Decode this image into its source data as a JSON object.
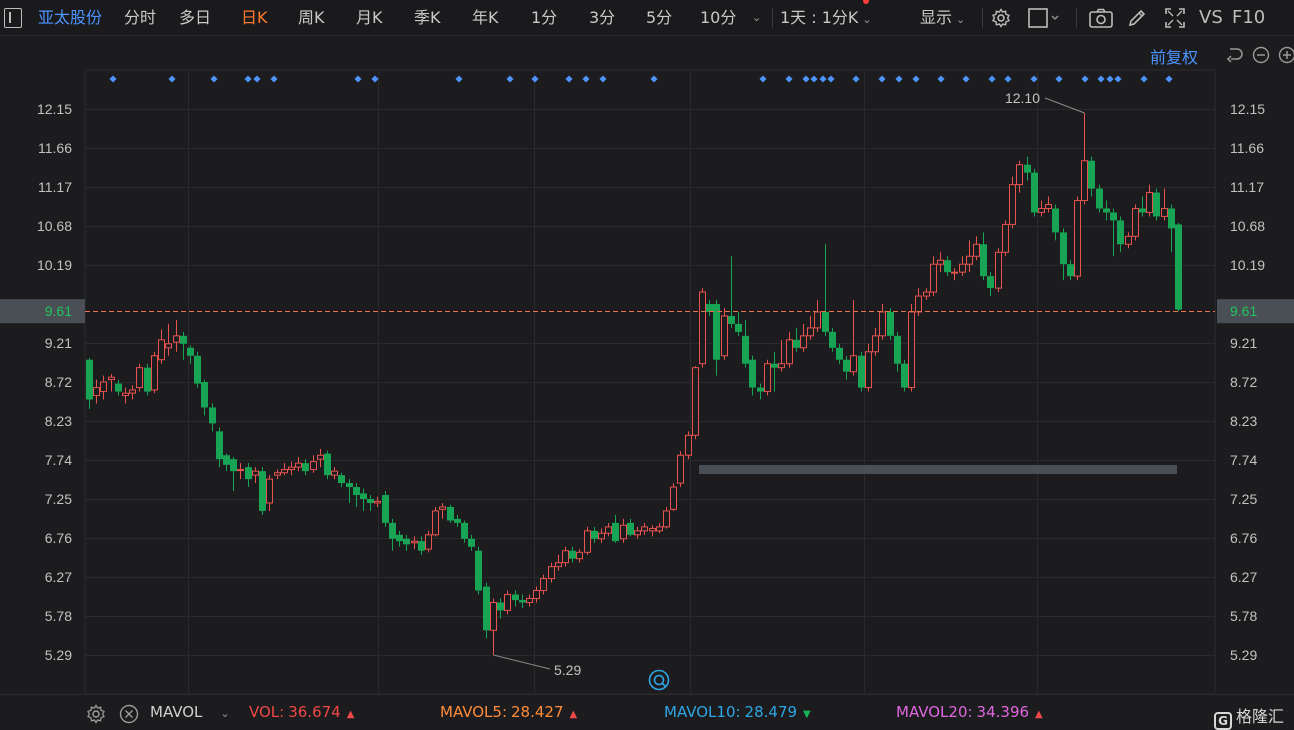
{
  "header": {
    "stock_name": "亚太股份",
    "tabs": [
      {
        "label": "分时"
      },
      {
        "label": "多日"
      },
      {
        "label": "日K"
      },
      {
        "label": "周K"
      },
      {
        "label": "月K"
      },
      {
        "label": "季K"
      },
      {
        "label": "年K"
      },
      {
        "label": "1分"
      },
      {
        "label": "3分"
      },
      {
        "label": "5分"
      },
      {
        "label": "10分"
      }
    ],
    "active_tab": "日K",
    "period_select": "1天 : 1分K",
    "display_label": "显示",
    "vs_label": "VS",
    "f10_label": "F10",
    "adjust_label": "前复权",
    "icons": [
      "sidebar-toggle-icon",
      "settings-gear-icon",
      "square-icon",
      "camera-icon",
      "pen-icon",
      "fullscreen-icon",
      "undo-icon",
      "zoom-out-icon",
      "zoom-in-icon"
    ]
  },
  "chart_data": {
    "type": "candlestick",
    "y_ticks": [
      "12.15",
      "11.66",
      "11.17",
      "10.68",
      "10.19",
      "9.61",
      "9.21",
      "8.72",
      "8.23",
      "7.74",
      "7.25",
      "6.76",
      "6.27",
      "5.78",
      "5.29"
    ],
    "ylim": [
      5.09,
      12.5
    ],
    "current_price": "9.61",
    "high_label": "12.10",
    "low_label": "5.29",
    "candles": [
      [
        9.0,
        8.5,
        9.02,
        8.38
      ],
      [
        8.55,
        8.65,
        8.75,
        8.45
      ],
      [
        8.6,
        8.72,
        8.8,
        8.5
      ],
      [
        8.75,
        8.78,
        8.82,
        8.6
      ],
      [
        8.7,
        8.6,
        8.75,
        8.55
      ],
      [
        8.55,
        8.58,
        8.65,
        8.45
      ],
      [
        8.58,
        8.62,
        8.68,
        8.5
      ],
      [
        8.65,
        8.9,
        8.95,
        8.6
      ],
      [
        8.9,
        8.6,
        8.95,
        8.55
      ],
      [
        8.62,
        9.05,
        9.1,
        8.58
      ],
      [
        9.0,
        9.25,
        9.38,
        8.95
      ],
      [
        9.15,
        9.2,
        9.45,
        9.05
      ],
      [
        9.22,
        9.3,
        9.5,
        9.1
      ],
      [
        9.3,
        9.2,
        9.35,
        9.0
      ],
      [
        9.15,
        9.05,
        9.18,
        8.95
      ],
      [
        9.05,
        8.7,
        9.1,
        8.65
      ],
      [
        8.72,
        8.4,
        8.75,
        8.3
      ],
      [
        8.4,
        8.2,
        8.45,
        8.1
      ],
      [
        8.1,
        7.75,
        8.15,
        7.65
      ],
      [
        7.8,
        7.68,
        7.82,
        7.6
      ],
      [
        7.75,
        7.6,
        7.78,
        7.35
      ],
      [
        7.62,
        7.62,
        7.7,
        7.5
      ],
      [
        7.65,
        7.5,
        7.7,
        7.4
      ],
      [
        7.55,
        7.6,
        7.65,
        7.45
      ],
      [
        7.6,
        7.1,
        7.65,
        7.05
      ],
      [
        7.2,
        7.5,
        7.55,
        7.1
      ],
      [
        7.55,
        7.58,
        7.62,
        7.5
      ],
      [
        7.58,
        7.62,
        7.7,
        7.55
      ],
      [
        7.62,
        7.65,
        7.72,
        7.55
      ],
      [
        7.65,
        7.7,
        7.78,
        7.6
      ],
      [
        7.7,
        7.6,
        7.75,
        7.55
      ],
      [
        7.62,
        7.72,
        7.8,
        7.58
      ],
      [
        7.75,
        7.8,
        7.88,
        7.65
      ],
      [
        7.82,
        7.55,
        7.86,
        7.5
      ],
      [
        7.55,
        7.6,
        7.65,
        7.5
      ],
      [
        7.55,
        7.45,
        7.58,
        7.4
      ],
      [
        7.45,
        7.4,
        7.5,
        7.2
      ],
      [
        7.4,
        7.3,
        7.45,
        7.15
      ],
      [
        7.32,
        7.25,
        7.38,
        7.1
      ],
      [
        7.25,
        7.2,
        7.3,
        7.1
      ],
      [
        7.2,
        7.22,
        7.28,
        7.15
      ],
      [
        7.3,
        6.95,
        7.35,
        6.9
      ],
      [
        6.95,
        6.75,
        7.0,
        6.6
      ],
      [
        6.8,
        6.72,
        6.85,
        6.65
      ],
      [
        6.75,
        6.68,
        6.8,
        6.6
      ],
      [
        6.7,
        6.72,
        6.78,
        6.62
      ],
      [
        6.72,
        6.6,
        6.78,
        6.55
      ],
      [
        6.62,
        6.8,
        6.85,
        6.58
      ],
      [
        6.8,
        7.1,
        7.15,
        6.78
      ],
      [
        7.12,
        7.15,
        7.2,
        7.0
      ],
      [
        7.15,
        6.98,
        7.18,
        6.95
      ],
      [
        7.0,
        6.95,
        7.05,
        6.9
      ],
      [
        6.95,
        6.75,
        6.98,
        6.7
      ],
      [
        6.75,
        6.65,
        6.8,
        6.6
      ],
      [
        6.6,
        6.1,
        6.65,
        6.05
      ],
      [
        6.15,
        5.6,
        6.2,
        5.5
      ],
      [
        5.6,
        5.95,
        6.0,
        5.29
      ],
      [
        5.95,
        5.85,
        6.0,
        5.75
      ],
      [
        5.85,
        6.05,
        6.1,
        5.8
      ],
      [
        6.05,
        5.98,
        6.1,
        5.9
      ],
      [
        5.98,
        5.95,
        6.05,
        5.88
      ],
      [
        5.95,
        6.0,
        6.05,
        5.9
      ],
      [
        6.0,
        6.1,
        6.15,
        5.95
      ],
      [
        6.1,
        6.25,
        6.3,
        6.05
      ],
      [
        6.25,
        6.4,
        6.45,
        6.2
      ],
      [
        6.4,
        6.45,
        6.55,
        6.35
      ],
      [
        6.45,
        6.6,
        6.65,
        6.4
      ],
      [
        6.6,
        6.5,
        6.65,
        6.45
      ],
      [
        6.5,
        6.58,
        6.62,
        6.45
      ],
      [
        6.58,
        6.85,
        6.9,
        6.55
      ],
      [
        6.85,
        6.75,
        6.9,
        6.7
      ],
      [
        6.75,
        6.82,
        6.88,
        6.7
      ],
      [
        6.82,
        6.9,
        6.95,
        6.78
      ],
      [
        6.95,
        6.72,
        7.05,
        6.7
      ],
      [
        6.75,
        6.92,
        7.0,
        6.7
      ],
      [
        6.95,
        6.8,
        7.0,
        6.78
      ],
      [
        6.8,
        6.85,
        6.9,
        6.75
      ],
      [
        6.85,
        6.9,
        6.95,
        6.8
      ],
      [
        6.85,
        6.88,
        6.92,
        6.78
      ],
      [
        6.85,
        6.9,
        6.95,
        6.82
      ],
      [
        6.9,
        7.1,
        7.15,
        6.88
      ],
      [
        7.12,
        7.4,
        7.45,
        7.1
      ],
      [
        7.45,
        7.8,
        7.85,
        7.4
      ],
      [
        7.8,
        8.05,
        8.1,
        7.75
      ],
      [
        8.05,
        8.9,
        8.92,
        8.0
      ],
      [
        8.95,
        9.85,
        9.9,
        8.9
      ],
      [
        9.7,
        9.6,
        9.75,
        9.55
      ],
      [
        9.7,
        9.0,
        9.75,
        8.8
      ],
      [
        9.05,
        9.55,
        9.65,
        9.0
      ],
      [
        9.55,
        9.45,
        10.3,
        9.4
      ],
      [
        9.45,
        9.35,
        9.6,
        9.3
      ],
      [
        9.3,
        8.95,
        9.5,
        8.9
      ],
      [
        9.0,
        8.65,
        9.05,
        8.55
      ],
      [
        8.65,
        8.6,
        8.7,
        8.5
      ],
      [
        8.6,
        8.95,
        9.0,
        8.55
      ],
      [
        8.95,
        8.9,
        9.1,
        8.6
      ],
      [
        8.9,
        8.95,
        9.25,
        8.85
      ],
      [
        8.95,
        9.25,
        9.35,
        8.9
      ],
      [
        9.25,
        9.15,
        9.4,
        9.1
      ],
      [
        9.15,
        9.3,
        9.45,
        9.1
      ],
      [
        9.3,
        9.4,
        9.55,
        9.25
      ],
      [
        9.4,
        9.6,
        9.75,
        9.35
      ],
      [
        9.6,
        9.35,
        10.45,
        9.3
      ],
      [
        9.35,
        9.15,
        9.4,
        9.1
      ],
      [
        9.15,
        9.0,
        9.2,
        8.95
      ],
      [
        9.0,
        8.85,
        9.05,
        8.75
      ],
      [
        8.85,
        9.05,
        9.75,
        8.8
      ],
      [
        9.05,
        8.65,
        9.1,
        8.6
      ],
      [
        8.65,
        9.1,
        9.2,
        8.6
      ],
      [
        9.1,
        9.3,
        9.4,
        9.05
      ],
      [
        9.3,
        9.6,
        9.7,
        9.25
      ],
      [
        9.6,
        9.3,
        9.65,
        9.25
      ],
      [
        9.3,
        8.95,
        9.35,
        8.85
      ],
      [
        8.95,
        8.65,
        9.0,
        8.6
      ],
      [
        8.65,
        9.6,
        9.7,
        8.6
      ],
      [
        9.6,
        9.8,
        9.9,
        9.55
      ],
      [
        9.8,
        9.85,
        9.9,
        9.75
      ],
      [
        9.85,
        10.2,
        10.3,
        9.8
      ],
      [
        10.2,
        10.25,
        10.35,
        10.1
      ],
      [
        10.25,
        10.1,
        10.3,
        10.05
      ],
      [
        10.1,
        10.1,
        10.15,
        10.0
      ],
      [
        10.1,
        10.2,
        10.3,
        10.05
      ],
      [
        10.2,
        10.3,
        10.5,
        10.1
      ],
      [
        10.3,
        10.45,
        10.55,
        10.25
      ],
      [
        10.45,
        10.05,
        10.6,
        10.0
      ],
      [
        10.05,
        9.9,
        10.1,
        9.8
      ],
      [
        9.9,
        10.35,
        10.4,
        9.85
      ],
      [
        10.35,
        10.7,
        10.75,
        10.3
      ],
      [
        10.7,
        11.2,
        11.3,
        10.65
      ],
      [
        11.2,
        11.45,
        11.5,
        11.1
      ],
      [
        11.45,
        11.35,
        11.55,
        11.25
      ],
      [
        11.35,
        10.85,
        11.4,
        10.8
      ],
      [
        10.85,
        10.9,
        11.0,
        10.8
      ],
      [
        10.9,
        10.95,
        11.05,
        10.85
      ],
      [
        10.9,
        10.6,
        10.95,
        10.5
      ],
      [
        10.6,
        10.2,
        10.65,
        10.0
      ],
      [
        10.2,
        10.05,
        10.25,
        10.0
      ],
      [
        10.05,
        11.0,
        11.05,
        10.0
      ],
      [
        11.0,
        11.5,
        12.1,
        10.95
      ],
      [
        11.5,
        11.15,
        11.55,
        11.05
      ],
      [
        11.15,
        10.9,
        11.2,
        10.85
      ],
      [
        10.9,
        10.85,
        11.0,
        10.75
      ],
      [
        10.85,
        10.75,
        10.9,
        10.3
      ],
      [
        10.75,
        10.45,
        10.8,
        10.35
      ],
      [
        10.45,
        10.55,
        10.6,
        10.4
      ],
      [
        10.55,
        10.9,
        10.95,
        10.5
      ],
      [
        10.9,
        10.85,
        11.05,
        10.8
      ],
      [
        10.85,
        11.1,
        11.2,
        10.8
      ],
      [
        11.1,
        10.8,
        11.15,
        10.75
      ],
      [
        10.8,
        10.9,
        11.15,
        10.75
      ],
      [
        10.9,
        10.65,
        10.95,
        10.35
      ],
      [
        10.7,
        9.63,
        10.72,
        9.61
      ]
    ]
  },
  "markers_count": 37,
  "volume": {
    "indicator": "MAVOL",
    "vol": {
      "label": "VOL:",
      "value": "36.674",
      "color": "#f04848",
      "trend": "up"
    },
    "mavol5": {
      "label": "MAVOL5:",
      "value": "28.427",
      "color": "#ff8c3a",
      "trend": "up"
    },
    "mavol10": {
      "label": "MAVOL10:",
      "value": "28.479",
      "color": "#2ea6e6",
      "trend": "down"
    },
    "mavol20": {
      "label": "MAVOL20:",
      "value": "34.396",
      "color": "#e066e0",
      "trend": "up"
    }
  },
  "brand": "格隆汇",
  "colors": {
    "up": "#e8524f",
    "down": "#17a555",
    "accent_blue": "#4d94ff",
    "active_tab": "#ff7a2f",
    "price_line": "#e8754a"
  }
}
